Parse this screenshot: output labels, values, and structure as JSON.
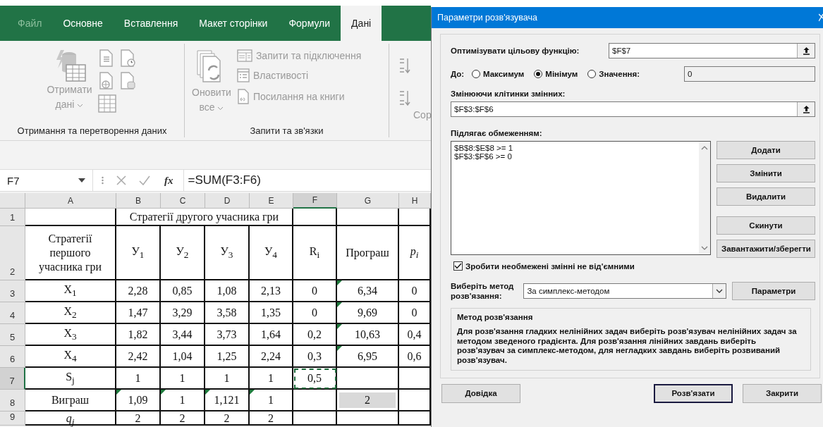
{
  "ribbon": {
    "tabs": [
      {
        "label": "Файл",
        "selected": false,
        "kind": "file"
      },
      {
        "label": "Основне",
        "selected": false,
        "kind": "tab"
      },
      {
        "label": "Вставлення",
        "selected": false,
        "kind": "tab"
      },
      {
        "label": "Макет сторінки",
        "selected": false,
        "kind": "tab"
      },
      {
        "label": "Формули",
        "selected": false,
        "kind": "tab"
      },
      {
        "label": "Дані",
        "selected": true,
        "kind": "tab"
      }
    ],
    "groups": [
      {
        "kind": "get_data",
        "label": "Отримання та перетворення даних",
        "button_lines": [
          "Отримати",
          "дані"
        ]
      },
      {
        "kind": "queries",
        "label": "Запити та зв'язки",
        "button_lines": [
          "Оновити",
          "все"
        ],
        "items": [
          {
            "kind": "queries",
            "label": "Запити та підключення"
          },
          {
            "kind": "properties",
            "label": "Властивості"
          },
          {
            "kind": "links",
            "label": "Посилання на книги"
          }
        ]
      },
      {
        "kind": "sort",
        "button_label": "Сор"
      }
    ]
  },
  "formula_bar": {
    "name_box": "F7",
    "fx": "fx",
    "formula": "=SUM(F3:F6)"
  },
  "sheet": {
    "columns": [
      {
        "label": "A",
        "selected": false
      },
      {
        "label": "B",
        "selected": false
      },
      {
        "label": "C",
        "selected": false
      },
      {
        "label": "D",
        "selected": false
      },
      {
        "label": "E",
        "selected": false
      },
      {
        "label": "F",
        "selected": true
      },
      {
        "label": "G",
        "selected": false
      },
      {
        "label": "H",
        "selected": false
      }
    ],
    "rows": [
      {
        "label": "1",
        "selected": false,
        "cells": [
          {},
          {
            "text": "Стратегії другого учасника гри",
            "kind": "merged"
          },
          {},
          {},
          {}
        ]
      },
      {
        "label": "2",
        "selected": false,
        "cells": [
          {
            "text": "Стратегії першого учасника гри"
          },
          {
            "text": "У$_{1}$"
          },
          {
            "text": "У$_{2}$"
          },
          {
            "text": "У$_{3}$"
          },
          {
            "text": "У$_{4}$"
          },
          {
            "text": "R$_{i}$"
          },
          {
            "text": "Програш"
          },
          {
            "text": "p$_{i}$",
            "italic": true
          }
        ]
      },
      {
        "label": "3",
        "selected": false,
        "cells": [
          {
            "text": "X$_{1}$"
          },
          {
            "text": "2,28"
          },
          {
            "text": "0,85"
          },
          {
            "text": "1,08"
          },
          {
            "text": "2,13"
          },
          {
            "text": "0"
          },
          {
            "text": "6,34",
            "flag": true
          },
          {
            "text": "0"
          }
        ]
      },
      {
        "label": "4",
        "selected": false,
        "cells": [
          {
            "text": "X$_{2}$"
          },
          {
            "text": "1,47"
          },
          {
            "text": "3,29"
          },
          {
            "text": "3,58"
          },
          {
            "text": "1,35"
          },
          {
            "text": "0"
          },
          {
            "text": "9,69",
            "flag": true
          },
          {
            "text": "0"
          }
        ]
      },
      {
        "label": "5",
        "selected": false,
        "cells": [
          {
            "text": "X$_{3}$"
          },
          {
            "text": "1,82"
          },
          {
            "text": "3,44"
          },
          {
            "text": "3,73"
          },
          {
            "text": "1,64"
          },
          {
            "text": "0,2"
          },
          {
            "text": "10,63",
            "flag": true
          },
          {
            "text": "0,4"
          }
        ]
      },
      {
        "label": "6",
        "selected": false,
        "cells": [
          {
            "text": "X$_{4}$"
          },
          {
            "text": "2,42"
          },
          {
            "text": "1,04"
          },
          {
            "text": "1,25"
          },
          {
            "text": "2,24"
          },
          {
            "text": "0,3"
          },
          {
            "text": "6,95",
            "flag": true
          },
          {
            "text": "0,6"
          }
        ]
      },
      {
        "label": "7",
        "selected": true,
        "cells": [
          {
            "text": "S$_{j}$"
          },
          {
            "text": "1"
          },
          {
            "text": "1"
          },
          {
            "text": "1"
          },
          {
            "text": "1"
          },
          {
            "text": "0,5",
            "selected": true
          },
          {},
          {}
        ]
      },
      {
        "label": "8",
        "selected": false,
        "cells": [
          {
            "text": "Виграш"
          },
          {
            "text": "1,09",
            "flag": true
          },
          {
            "text": "1",
            "flag": true
          },
          {
            "text": "1,121",
            "flag": true
          },
          {
            "text": "1",
            "flag": true
          },
          {},
          {
            "text": "2",
            "highlighted": true
          },
          {}
        ]
      },
      {
        "label": "9",
        "selected": false,
        "cells": [
          {
            "text": "q$_{j}$",
            "italic": true
          },
          {
            "text": "2"
          },
          {
            "text": "2"
          },
          {
            "text": "2"
          },
          {
            "text": "2"
          },
          {},
          {},
          {}
        ]
      }
    ]
  },
  "dialog": {
    "title": "Параметри розв'язувача",
    "objective": {
      "label": "Оптимізувати цільову функцію:",
      "value": "$F$7"
    },
    "target": {
      "label": "До:",
      "options": [
        {
          "label": "Максимум",
          "selected": false
        },
        {
          "label": "Мінімум",
          "selected": true
        },
        {
          "label": "Значення:",
          "selected": false
        }
      ],
      "value": "0"
    },
    "variables": {
      "label": "Змінюючи клітинки змінних:",
      "value": "$F$3:$F$6"
    },
    "constraints": {
      "label": "Підлягає обмеженням:",
      "items": [
        "$B$8:$E$8 >= 1",
        "$F$3:$F$6 >= 0"
      ]
    },
    "side_buttons": [
      {
        "label": "Додати"
      },
      {
        "label": "Змінити"
      },
      {
        "label": "Видалити"
      },
      {
        "label": "Скинути"
      },
      {
        "label": "Завантажити/зберегти"
      }
    ],
    "nonnegative": {
      "label": "Зробити необмежені змінні не від'ємними",
      "checked": true
    },
    "method": {
      "label": "Виберіть метод розв'язання:",
      "value": "За симплекс-методом",
      "button": "Параметри"
    },
    "method_info": {
      "title": "Метод розв'язання",
      "text": "Для розв'язання гладких нелінійних задач виберіть розв'язувач нелінійних задач за методом зведеного градієнта. Для розв'язання лінійних завдань виберіть розв'язувач за симплекс-методом, для негладких завдань виберіть розвиваний розв'язувач."
    },
    "footer_buttons": [
      {
        "label": "Довідка",
        "default": false
      },
      {
        "label": "Розв'язати",
        "default": true
      },
      {
        "label": "Закрити",
        "default": false
      }
    ]
  }
}
